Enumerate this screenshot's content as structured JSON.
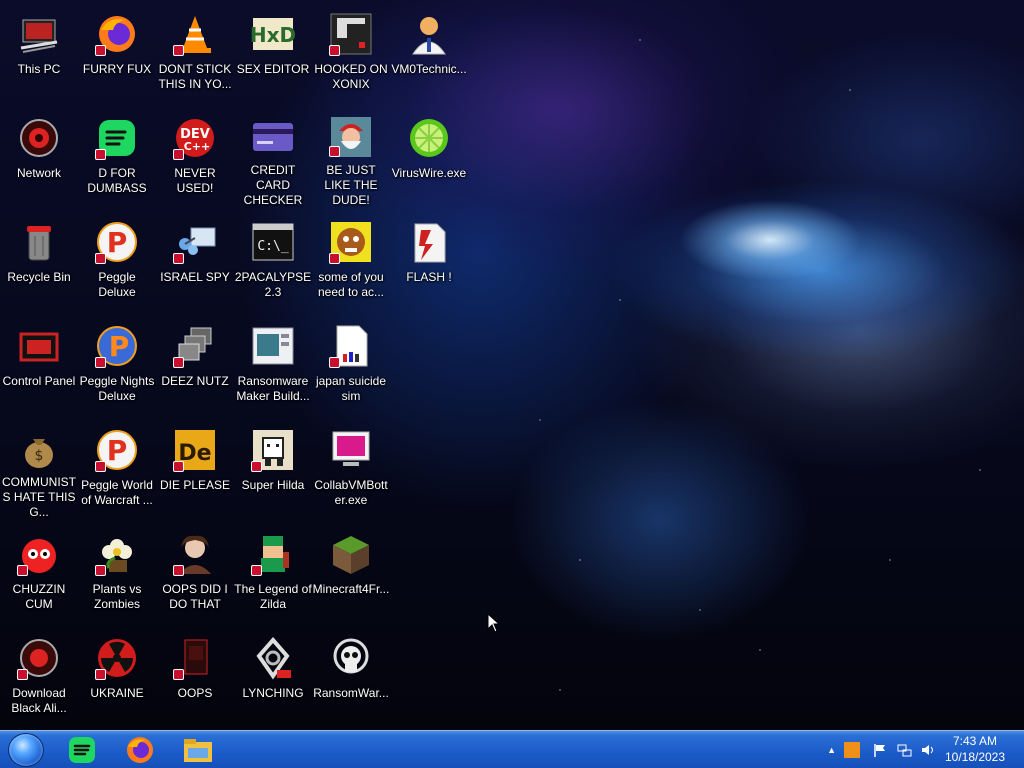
{
  "desktop": {
    "icons": [
      {
        "key": "this-pc",
        "label": "This PC",
        "icon": "computer-icon"
      },
      {
        "key": "network",
        "label": "Network",
        "icon": "network-icon"
      },
      {
        "key": "recycle-bin",
        "label": "Recycle Bin",
        "icon": "recycle-bin-icon"
      },
      {
        "key": "control-panel",
        "label": "Control Panel",
        "icon": "control-panel-icon"
      },
      {
        "key": "communists",
        "label": "COMMUNISTS HATE THIS G...",
        "icon": "money-bag-icon"
      },
      {
        "key": "chuzzin",
        "label": "CHUZZIN CUM",
        "icon": "chuzzle-icon"
      },
      {
        "key": "download-black",
        "label": "Download Black Ali...",
        "icon": "alien-icon"
      },
      {
        "key": "furry-fux",
        "label": "FURRY FUX",
        "icon": "firefox-icon"
      },
      {
        "key": "d-for-dumbass",
        "label": "D FOR DUMBASS",
        "icon": "spotify-icon"
      },
      {
        "key": "peggle-deluxe",
        "label": "Peggle Deluxe",
        "icon": "peggle-icon"
      },
      {
        "key": "peggle-nights",
        "label": "Peggle Nights Deluxe",
        "icon": "peggle-nights-icon"
      },
      {
        "key": "peggle-world",
        "label": "Peggle World of Warcraft ...",
        "icon": "peggle-icon"
      },
      {
        "key": "plants-vs-zombies",
        "label": "Plants vs Zombies",
        "icon": "flower-icon"
      },
      {
        "key": "ukraine",
        "label": "UKRAINE",
        "icon": "radiation-icon"
      },
      {
        "key": "dont-stick",
        "label": "DONT STICK THIS IN YO...",
        "icon": "vlc-cone-icon"
      },
      {
        "key": "never-used",
        "label": "NEVER USED!",
        "icon": "devcpp-icon"
      },
      {
        "key": "israel-spy",
        "label": "ISRAEL SPY",
        "icon": "remote-desktop-icon"
      },
      {
        "key": "deez-nutz",
        "label": "DEEZ NUTZ",
        "icon": "windows-stack-icon"
      },
      {
        "key": "die-please",
        "label": "DIE PLEASE",
        "icon": "de-icon"
      },
      {
        "key": "oops-did-i",
        "label": "OOPS DID I DO THAT",
        "icon": "portrait-icon"
      },
      {
        "key": "oops",
        "label": "OOPS",
        "icon": "book-icon"
      },
      {
        "key": "sex-editor",
        "label": "SEX EDITOR",
        "icon": "hxd-icon"
      },
      {
        "key": "credit-card",
        "label": "CREDIT CARD CHECKER",
        "icon": "credit-card-icon"
      },
      {
        "key": "2pacalypse",
        "label": "2PACALYPSE 2.3",
        "icon": "cmd-icon"
      },
      {
        "key": "ransomware-maker",
        "label": "Ransomware Maker Build...",
        "icon": "window-app-icon"
      },
      {
        "key": "super-hilda",
        "label": "Super Hilda",
        "icon": "pixel-cat-icon"
      },
      {
        "key": "legend-of-zilda",
        "label": "The Legend of Zilda",
        "icon": "pixel-hero-icon"
      },
      {
        "key": "lynching",
        "label": "LYNCHING",
        "icon": "knot-icon"
      },
      {
        "key": "hooked-on-xonix",
        "label": "HOOKED ON XONIX",
        "icon": "xonix-icon"
      },
      {
        "key": "be-just-like",
        "label": "BE JUST LIKE THE DUDE!",
        "icon": "santa-icon"
      },
      {
        "key": "some-of-you",
        "label": "some of you need to ac...",
        "icon": "dog-icon"
      },
      {
        "key": "japan-suicide",
        "label": "japan suicide sim",
        "icon": "file-icon"
      },
      {
        "key": "collabvm",
        "label": "CollabVMBott er.exe",
        "icon": "monitor-icon"
      },
      {
        "key": "minecraft",
        "label": "Minecraft4Fr...",
        "icon": "grass-block-icon"
      },
      {
        "key": "ransomwar",
        "label": "RansomWar...",
        "icon": "skull-icon"
      },
      {
        "key": "vm0technic",
        "label": "VM0Technic...",
        "icon": "doctor-icon"
      },
      {
        "key": "viruswire",
        "label": "VirusWire.exe",
        "icon": "lime-icon"
      },
      {
        "key": "flash",
        "label": "FLASH !",
        "icon": "flash-icon"
      }
    ]
  },
  "taskbar": {
    "start": "start-orb-icon",
    "pinned": [
      "spotify-icon",
      "firefox-icon",
      "file-explorer-icon"
    ],
    "tray": {
      "chevron": "▲",
      "time": "7:43 AM",
      "date": "10/18/2023"
    }
  },
  "colors": {
    "taskbar": "#1b5bc8",
    "shortcut_badge": "#c8102e"
  }
}
